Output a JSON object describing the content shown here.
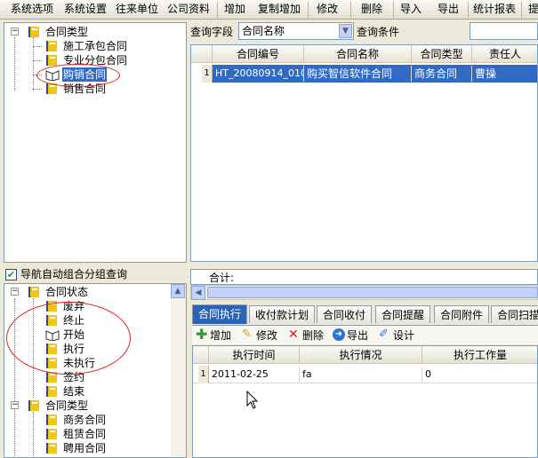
{
  "toolbar": {
    "items": [
      "系统选项",
      "系统设置",
      "往来单位",
      "公司资料",
      "增加",
      "复制增加",
      "修改",
      "删除",
      "导入",
      "导出",
      "统计报表",
      "提"
    ]
  },
  "tree_top": {
    "root": "合同类型",
    "children": [
      "施工承包合同",
      "专业分包合同",
      "购销合同",
      "销售合同"
    ],
    "selected": "购销合同"
  },
  "nav_checkbox_label": "导航自动组合分组查询",
  "tree_bottom": {
    "group1": "合同状态",
    "group1_children": [
      "废弃",
      "终止",
      "开始",
      "执行",
      "未执行",
      "签约",
      "结束"
    ],
    "group2": "合同类型",
    "group2_children": [
      "商务合同",
      "租赁合同",
      "聘用合同"
    ]
  },
  "query": {
    "field_label": "查询字段",
    "field_value": "合同名称",
    "condition_label": "查询条件",
    "condition_value": ""
  },
  "main_grid": {
    "columns": [
      "合同编号",
      "合同名称",
      "合同类型",
      "责任人"
    ],
    "rows": [
      {
        "num": "1",
        "cells": [
          "HT_20080914_010",
          "购买智信软件合同",
          "商务合同",
          "曹操"
        ]
      }
    ],
    "total_label": "合计:"
  },
  "tabs": [
    "合同执行",
    "收付款计划",
    "合同收付",
    "合同提醒",
    "合同附件",
    "合同扫描"
  ],
  "active_tab": "合同执行",
  "sub_toolbar": [
    "增加",
    "修改",
    "删除",
    "导出",
    "设计"
  ],
  "detail_grid": {
    "columns": [
      "执行时间",
      "执行情况",
      "执行工作量"
    ],
    "rows": [
      {
        "num": "1",
        "cells": [
          "2011-02-25",
          "fa",
          "0"
        ]
      }
    ]
  }
}
